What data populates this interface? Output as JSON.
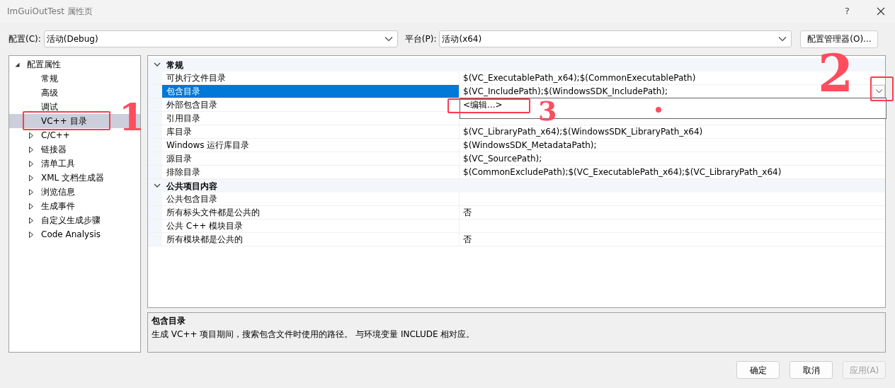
{
  "window": {
    "title": "ImGuiOutTest 属性页",
    "help": "?"
  },
  "config": {
    "label": "配置(C):",
    "value": "活动(Debug)"
  },
  "platform": {
    "label": "平台(P):",
    "value": "活动(x64)"
  },
  "config_manager_button": "配置管理器(O)...",
  "tree": [
    {
      "label": "配置属性",
      "kind": "group",
      "expanded": true,
      "selected": false,
      "children": [
        {
          "label": "常规",
          "kind": "page",
          "selected": false
        },
        {
          "label": "高级",
          "kind": "page",
          "selected": false
        },
        {
          "label": "调试",
          "kind": "page",
          "selected": false
        },
        {
          "label": "VC++ 目录",
          "kind": "page",
          "selected": true
        },
        {
          "label": "C/C++",
          "kind": "group",
          "expanded": false,
          "selected": false
        },
        {
          "label": "链接器",
          "kind": "group",
          "expanded": false,
          "selected": false
        },
        {
          "label": "清单工具",
          "kind": "group",
          "expanded": false,
          "selected": false
        },
        {
          "label": "XML 文档生成器",
          "kind": "group",
          "expanded": false,
          "selected": false
        },
        {
          "label": "浏览信息",
          "kind": "group",
          "expanded": false,
          "selected": false
        },
        {
          "label": "生成事件",
          "kind": "group",
          "expanded": false,
          "selected": false
        },
        {
          "label": "自定义生成步骤",
          "kind": "group",
          "expanded": false,
          "selected": false
        },
        {
          "label": "Code Analysis",
          "kind": "group",
          "expanded": false,
          "selected": false
        }
      ]
    }
  ],
  "grid": {
    "sections": [
      {
        "title": "常规",
        "expanded": true,
        "rows": [
          {
            "name": "可执行文件目录",
            "value": "$(VC_ExecutablePath_x64);$(CommonExecutablePath)",
            "selected": false
          },
          {
            "name": "包含目录",
            "value": "$(VC_IncludePath);$(WindowsSDK_IncludePath);",
            "selected": true,
            "dropdown": {
              "open": true,
              "options": [
                "<编辑...>"
              ]
            }
          },
          {
            "name": "外部包含目录",
            "selected": false
          },
          {
            "name": "引用目录",
            "selected": false
          },
          {
            "name": "库目录",
            "value": "$(VC_LibraryPath_x64);$(WindowsSDK_LibraryPath_x64)",
            "selected": false
          },
          {
            "name": "Windows 运行库目录",
            "value": "$(WindowsSDK_MetadataPath);",
            "selected": false
          },
          {
            "name": "源目录",
            "value": "$(VC_SourcePath);",
            "selected": false
          },
          {
            "name": "排除目录",
            "value": "$(CommonExcludePath);$(VC_ExecutablePath_x64);$(VC_LibraryPath_x64)",
            "selected": false
          }
        ]
      },
      {
        "title": "公共项目内容",
        "expanded": true,
        "rows": [
          {
            "name": "公共包含目录",
            "selected": false
          },
          {
            "name": "所有标头文件都是公共的",
            "value": "否",
            "selected": false
          },
          {
            "name": "公共 C++ 模块目录",
            "selected": false
          },
          {
            "name": "所有模块都是公共的",
            "value": "否",
            "selected": false
          }
        ]
      }
    ]
  },
  "description": {
    "title": "包含目录",
    "text": "生成 VC++ 项目期间，搜索包含文件时使用的路径。  与环境变量 INCLUDE 相对应。"
  },
  "buttons": [
    {
      "label": "确定",
      "disabled": false
    },
    {
      "label": "取消",
      "disabled": false
    },
    {
      "label": "应用(A)",
      "disabled": true
    }
  ],
  "annotations": [
    {
      "label": "1"
    },
    {
      "label": "2"
    },
    {
      "label": "3"
    }
  ]
}
